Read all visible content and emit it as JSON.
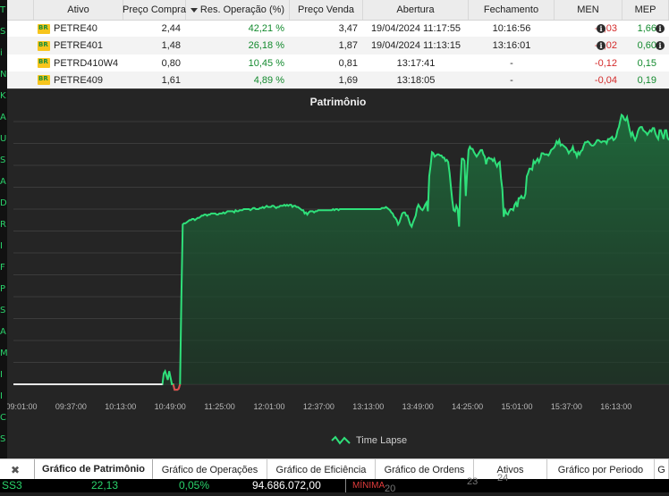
{
  "left_strip_chars": [
    "T",
    "S",
    "i",
    "N",
    "K",
    "A",
    "U",
    "S",
    "A",
    "D",
    "R",
    "I",
    "F",
    "P",
    "S",
    "A",
    "M",
    "I",
    "I",
    "C",
    "S"
  ],
  "table": {
    "headers": [
      "Ativo",
      "Preço Compra",
      "Res. Operação (%)",
      "Preço Venda",
      "Abertura",
      "Fechamento",
      "MEN",
      "MEP"
    ],
    "rows": [
      {
        "ativo": "PETRE40",
        "compra": "2,44",
        "res": "42,21 %",
        "venda": "3,47",
        "abertura": "19/04/2024 11:17:55",
        "fechamento": "10:16:56",
        "men": "-0,03",
        "mep": "1,66",
        "info": true
      },
      {
        "ativo": "PETRE401",
        "compra": "1,48",
        "res": "26,18 %",
        "venda": "1,87",
        "abertura": "19/04/2024 11:13:15",
        "fechamento": "13:16:01",
        "men": "-0,02",
        "mep": "0,60",
        "info": true
      },
      {
        "ativo": "PETRD410W4",
        "compra": "0,80",
        "res": "10,45 %",
        "venda": "0,81",
        "abertura": "13:17:41",
        "fechamento": "-",
        "men": "-0,12",
        "mep": "0,15",
        "info": false
      },
      {
        "ativo": "PETRE409",
        "compra": "1,61",
        "res": "4,89 %",
        "venda": "1,69",
        "abertura": "13:18:05",
        "fechamento": "-",
        "men": "-0,04",
        "mep": "0,19",
        "info": false
      }
    ]
  },
  "chart_data": {
    "type": "area",
    "title": "Patrimônio",
    "legend": "Time Lapse",
    "x_ticks": [
      "09:01:00",
      "09:37:00",
      "10:13:00",
      "10:49:00",
      "11:25:00",
      "12:01:00",
      "12:37:00",
      "13:13:00",
      "13:49:00",
      "14:25:00",
      "15:01:00",
      "15:37:00",
      "16:13:00"
    ],
    "series": [
      {
        "values": [
          0,
          0,
          0,
          0,
          0,
          0,
          0,
          0,
          0,
          0,
          0,
          0,
          0,
          0,
          0,
          0,
          0,
          0,
          0,
          0,
          0,
          0,
          0,
          0,
          0,
          0,
          0,
          0,
          0,
          0,
          0,
          0,
          0,
          0,
          0,
          0,
          0,
          0,
          0,
          0,
          0,
          0,
          0,
          0,
          0,
          0,
          0,
          0,
          0,
          0,
          0,
          0,
          0,
          0,
          0,
          0,
          0,
          0,
          0,
          0,
          0,
          0,
          0,
          0,
          0,
          0,
          0,
          0,
          0,
          0,
          0,
          0,
          0,
          0,
          0,
          0,
          0,
          0,
          0,
          0,
          0,
          0,
          0,
          0,
          0,
          0,
          0,
          0,
          0,
          0,
          0,
          0,
          0,
          0,
          0,
          0,
          0,
          0,
          0,
          0,
          0,
          0,
          0,
          0,
          0,
          0,
          0,
          0,
          0,
          0,
          0,
          0.5,
          0.6,
          0.4,
          0.2,
          0.6,
          0.3,
          0,
          0,
          -0.25,
          -0.25,
          -0.25,
          -0.2,
          0,
          4,
          7.3,
          7.35,
          7.35,
          7.4,
          7.45,
          7.5,
          7.5,
          7.55,
          7.55,
          7.5,
          7.55,
          7.6,
          7.6,
          7.65,
          7.7,
          7.7,
          7.75,
          7.75,
          7.7,
          7.75,
          7.75,
          7.8,
          7.8,
          7.8,
          7.8,
          7.75,
          7.75,
          7.8,
          7.8,
          7.8,
          7.85,
          7.8,
          7.85,
          7.9,
          7.9,
          7.9,
          7.9,
          7.9,
          7.85,
          7.95,
          7.9,
          7.9,
          7.95,
          7.95,
          7.95,
          8,
          8,
          8,
          8,
          8,
          7.95,
          8,
          8.05,
          8.05,
          8,
          8,
          8,
          8.05,
          8.05,
          8.1,
          8.05,
          8.1,
          8.15,
          8.1,
          8.1,
          8.1,
          8.15,
          8.15,
          8.1,
          8.05,
          8.1,
          8.1,
          8.15,
          8.15,
          8.15,
          8.2,
          8.15,
          8.2,
          8.15,
          8.2,
          8.2,
          8.1,
          8.15,
          8.15,
          8.1,
          8.1,
          8.05,
          8,
          7.95,
          7.95,
          7.8,
          7.85,
          7.75,
          7.85,
          7.9,
          7.9,
          7.9,
          7.85,
          7.9,
          7.9,
          7.95,
          7.95,
          7.95,
          7.95,
          7.95,
          7.95,
          7.95,
          7.95,
          7.95,
          7.95,
          7.95,
          8,
          7.95,
          8,
          8,
          7.95,
          8,
          8,
          8,
          8,
          8,
          8,
          8,
          8,
          8,
          8,
          8,
          8,
          8,
          8,
          8,
          8,
          8,
          8,
          8,
          8,
          8,
          8,
          8,
          8,
          8,
          8,
          8,
          8,
          8,
          8,
          8,
          8.05,
          8.05,
          8.05,
          8.1,
          8.05,
          8,
          7.95,
          7.85,
          7.8,
          7.65,
          7.6,
          7.5,
          7.3,
          7.4,
          7.6,
          7.8,
          7.85,
          7.85,
          7.7,
          7.7,
          7.5,
          7.3,
          7.2,
          7.4,
          7.55,
          7.7,
          8.05,
          8.2,
          8.1,
          8,
          7.95,
          8.05,
          8.2,
          8.3,
          7.9,
          9.5,
          10,
          10.6,
          10.55,
          10.4,
          10.45,
          10.5,
          10.5,
          10.45,
          10.45,
          10.35,
          10.35,
          10.2,
          10.25,
          10.15,
          9.65,
          9,
          8.4,
          7.95,
          7.9,
          8.15,
          8,
          7.2,
          9.2,
          10.3,
          10.3,
          10.2,
          8.6,
          9.7,
          10.7,
          10.85,
          10.75,
          10.75,
          10.6,
          10.5,
          10.4,
          10.5,
          10.6,
          10.7,
          10.7,
          10.5,
          10.4,
          10.05,
          10.3,
          10.35,
          10.3,
          10.3,
          10.2,
          10.3,
          10.1,
          9.95,
          10.1,
          10.15,
          9.4,
          8.9,
          7.65,
          7.95,
          7.8,
          7.75,
          7.9,
          8,
          8,
          7.95,
          8.2,
          8.3,
          8.1,
          8.5,
          8.5,
          8.6,
          8.5,
          8.5,
          8.7,
          9.5,
          9.65,
          9.85,
          9.85,
          9.8,
          10.2,
          10.1,
          10.2,
          10.3,
          10.15,
          10.3,
          10.55,
          10.55,
          10.5,
          10.5,
          10.5,
          10.45,
          10.55,
          10.7,
          10.75,
          10.8,
          10.9,
          11.1,
          11,
          11.15,
          10.9,
          10.95,
          10.9,
          10.85,
          10.8,
          10.7,
          10.55,
          10.65,
          10.7,
          10.85,
          10.6,
          10.6,
          10.4,
          10.6,
          10.5,
          10.65,
          10.7,
          10.9,
          11.05,
          11.05,
          11.1,
          11.05,
          10.95,
          10.9,
          10.9,
          10.95,
          11.05,
          11.15,
          11.15,
          11.1,
          11.05,
          11.1,
          11.1,
          11.1,
          11,
          11.2,
          11.2,
          11.25,
          11.3,
          11.15,
          11.2,
          11.3,
          11.6,
          11.75,
          12.05,
          12.3,
          12.25,
          12.1,
          12.05,
          12.2,
          11.9,
          11.6,
          11.35,
          11.5,
          11.3,
          11.15,
          11.3,
          11.55,
          11.7,
          11.75,
          11.75,
          11.6,
          11.55,
          11.5,
          11.4,
          11.5,
          11.6,
          11.55,
          11.7,
          11.7,
          11.45,
          11.3,
          11.2,
          11.6,
          11.6,
          11.4,
          11.2,
          11.6,
          11.6,
          11.25,
          11.15
        ]
      }
    ]
  },
  "tabs": [
    "Gráfico de Patrimônio",
    "Gráfico de Operações",
    "Gráfico de Eficiência",
    "Gráfico de Ordens",
    "Ativos",
    "Gráfico por Periodo",
    "G"
  ],
  "ticker": {
    "symbol": "SS3",
    "price": "22,13",
    "change": "0,05%",
    "volume": "94.686.072,00",
    "label": "MÍNIMA",
    "extra1": "20",
    "extra2": "23",
    "extra3": "24"
  }
}
